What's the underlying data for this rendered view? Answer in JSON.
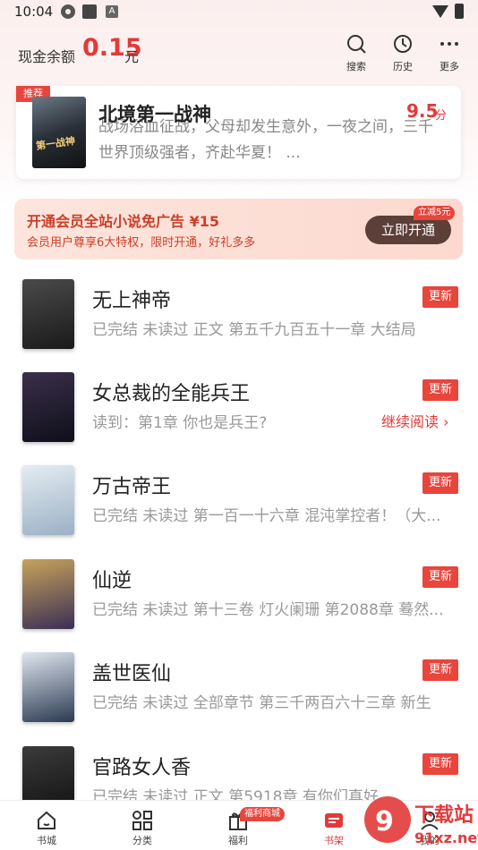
{
  "status_bar": {
    "time": "10:04",
    "a_icon": "A"
  },
  "header": {
    "cash_label": "现金余额",
    "cash_value": "0.15",
    "cash_unit": "元",
    "search_label": "搜索",
    "history_label": "历史",
    "more_label": "更多"
  },
  "recommend": {
    "tag": "推荐",
    "cover_text": "第一战神",
    "title": "北境第一战神",
    "score": "9.5",
    "score_unit": "分",
    "desc": "战场浴血征战，父母却发生意外，一夜之间，三千世界顶级强者，齐赴华夏！ ..."
  },
  "vip": {
    "title": "开通会员全站小说免广告 ¥15",
    "sub": "会员用户尊享6大特权，限时开通，好礼多多",
    "button": "立即开通",
    "badge": "立减5元"
  },
  "books": [
    {
      "title": "无上神帝",
      "sub": "已完结 未读过 正文 第五千九百五十一章 大结局",
      "badge": "更新",
      "cover_colors": [
        "#4a4a4a",
        "#1a1a1a"
      ]
    },
    {
      "title": "女总裁的全能兵王",
      "sub": "读到：第1章 你也是兵王?",
      "badge": "更新",
      "continue": "继续阅读 ›",
      "cover_colors": [
        "#3a2f4a",
        "#0f0f1a"
      ]
    },
    {
      "title": "万古帝王",
      "sub": "已完结 未读过 第一百一十六章 混沌掌控者！（大...",
      "badge": "更新",
      "cover_colors": [
        "#e4ecf2",
        "#9bb1c4"
      ]
    },
    {
      "title": "仙逆",
      "sub": "已完结 未读过 第十三卷 灯火阑珊 第2088章 蓦然...",
      "badge": "更新",
      "cover_colors": [
        "#c8a35a",
        "#3a2f55"
      ]
    },
    {
      "title": "盖世医仙",
      "sub": "已完结 未读过 全部章节 第三千两百六十三章 新生",
      "badge": "更新",
      "cover_colors": [
        "#dfe6ee",
        "#2b3a52"
      ]
    },
    {
      "title": "官路女人香",
      "sub": "已完结 未读过 正文 第5918章 有你们真好",
      "badge": "更新",
      "cover_colors": [
        "#3b3b3b",
        "#101010"
      ]
    }
  ],
  "bottom_nav": {
    "items": [
      {
        "label": "书城",
        "icon": "home-icon"
      },
      {
        "label": "分类",
        "icon": "grid-icon"
      },
      {
        "label": "福利",
        "icon": "gift-icon"
      },
      {
        "label": "书架",
        "icon": "bookshelf-icon"
      },
      {
        "label": "我的",
        "icon": "user-icon"
      }
    ],
    "welfare_tag": "福利商城"
  },
  "watermark": {
    "text": "下载站",
    "url_text": "91xz.net"
  },
  "colors": {
    "accent": "#e23a3a",
    "badge": "#e8453c",
    "vip_button": "#5c3f38"
  }
}
